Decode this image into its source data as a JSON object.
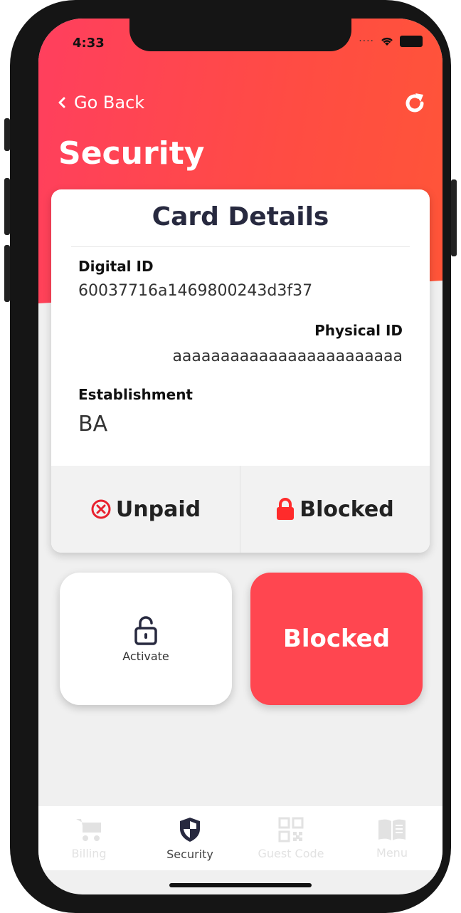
{
  "status": {
    "time": "4:33"
  },
  "header": {
    "back_label": "Go Back",
    "title": "Security"
  },
  "card": {
    "title": "Card Details",
    "digital_id_label": "Digital ID",
    "digital_id_value": "60037716a1469800243d3f37",
    "physical_id_label": "Physical ID",
    "physical_id_value": "aaaaaaaaaaaaaaaaaaaaaaaa",
    "establishment_label": "Establishment",
    "establishment_value": "BA",
    "payment_status": "Unpaid",
    "lock_status": "Blocked"
  },
  "actions": {
    "activate_label": "Activate",
    "blocked_label": "Blocked"
  },
  "tabs": [
    {
      "label": "Billing",
      "icon": "cart-icon"
    },
    {
      "label": "Security",
      "icon": "shield-icon"
    },
    {
      "label": "Guest Code",
      "icon": "qr-code-icon"
    },
    {
      "label": "Menu",
      "icon": "book-icon"
    }
  ],
  "colors": {
    "accent": "#ff4650",
    "hero_start": "#ff3f5e",
    "hero_end": "#ff5538",
    "text_dark": "#27293f"
  }
}
